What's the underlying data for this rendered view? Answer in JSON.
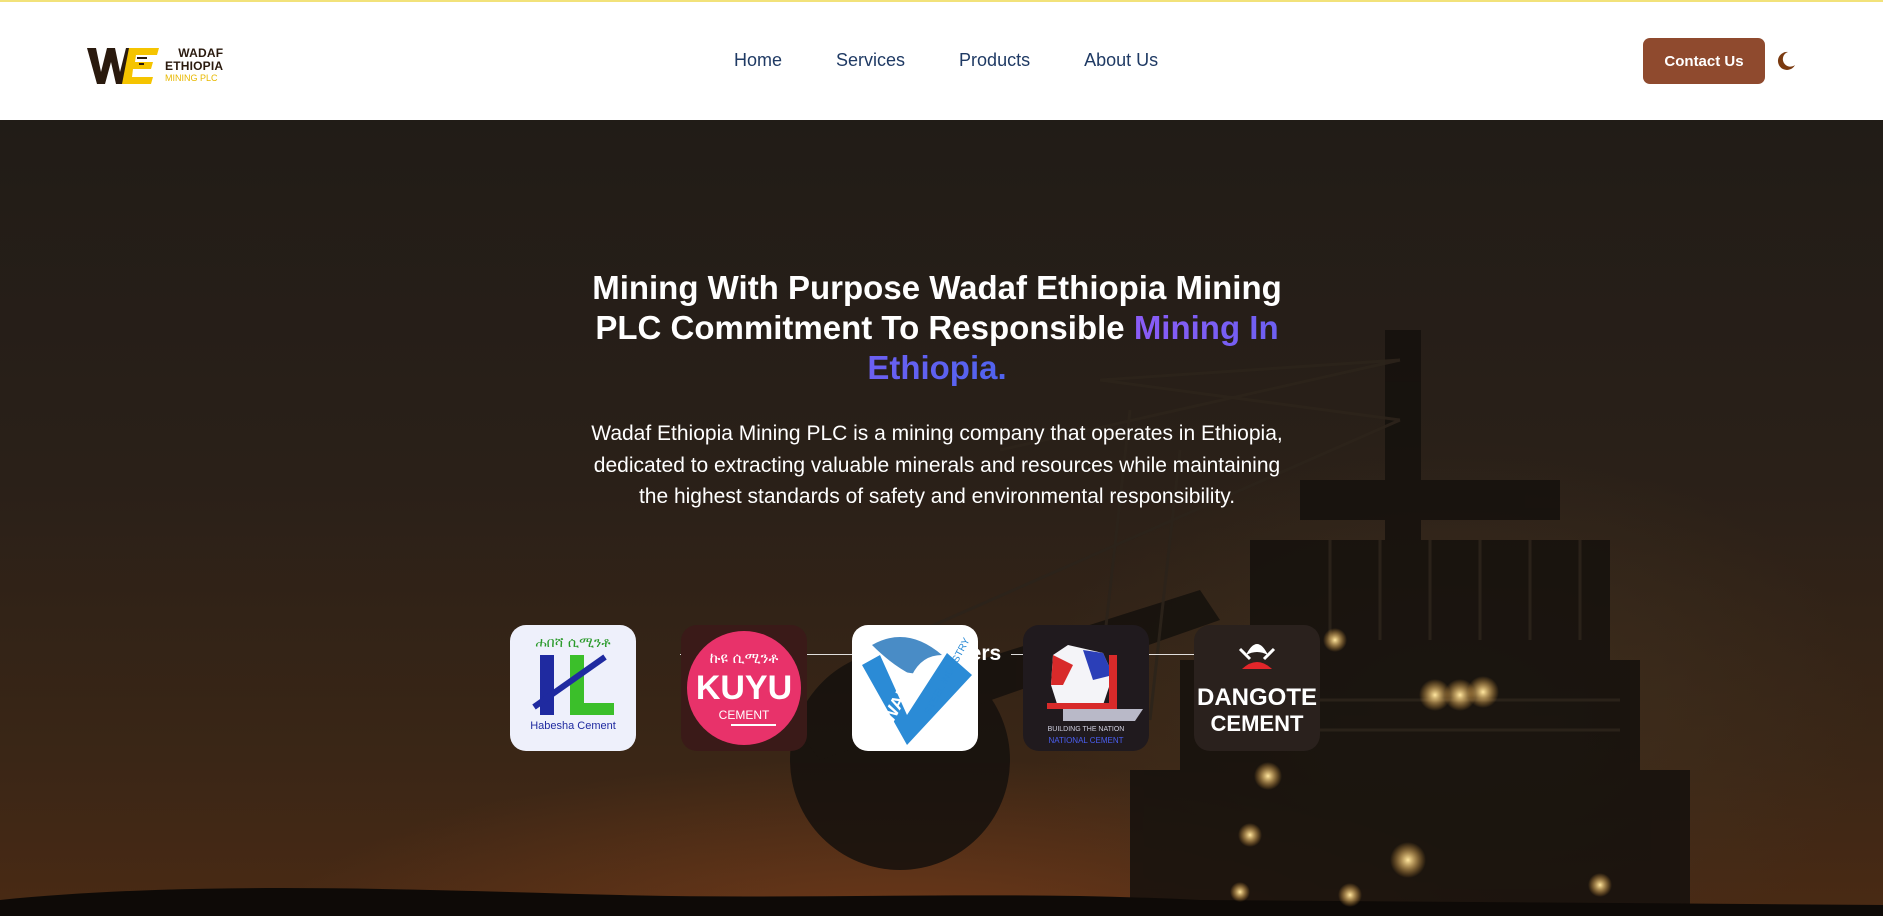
{
  "header": {
    "logo": {
      "line1": "WADAF",
      "line2": "ETHIOPIA",
      "line3": "MINING PLC"
    },
    "nav": [
      {
        "label": "Home"
      },
      {
        "label": "Services"
      },
      {
        "label": "Products"
      },
      {
        "label": "About Us"
      }
    ],
    "contact_label": "Contact Us",
    "theme_toggle_icon": "moon-icon"
  },
  "hero": {
    "headline_main": "Mining With Purpose Wadaf Ethiopia Mining PLC Commitment To Responsible ",
    "headline_accent": "Mining In Ethiopia.",
    "description": "Wadaf Ethiopia Mining PLC is a mining company that operates in Ethiopia, dedicated to extracting valuable minerals and resources while maintaining the highest standards of safety and environmental responsibility."
  },
  "partners": {
    "title": "Our Partners",
    "items": [
      {
        "name": "Habesha Cement",
        "amharic": "ሐበሻ ሲሚንቶ"
      },
      {
        "name": "KUYU",
        "sub": "CEMENT",
        "amharic": "ኩዩ ሲሚንቶ"
      },
      {
        "name": "WALIA",
        "sub": "STEEL INDUSTRY"
      },
      {
        "name": "BUILDING THE NATION",
        "sub": "NATIONAL CEMENT"
      },
      {
        "name": "DANGOTE",
        "sub": "CEMENT"
      }
    ]
  },
  "colors": {
    "topline": "#f2e27a",
    "nav_text": "#1f3a64",
    "contact_button": "#8f4a2e",
    "accent_gradient_start": "#8b5cf6",
    "accent_gradient_end": "#4f63ee",
    "logo_yellow": "#f5c400",
    "logo_dark": "#2a1a0e"
  }
}
